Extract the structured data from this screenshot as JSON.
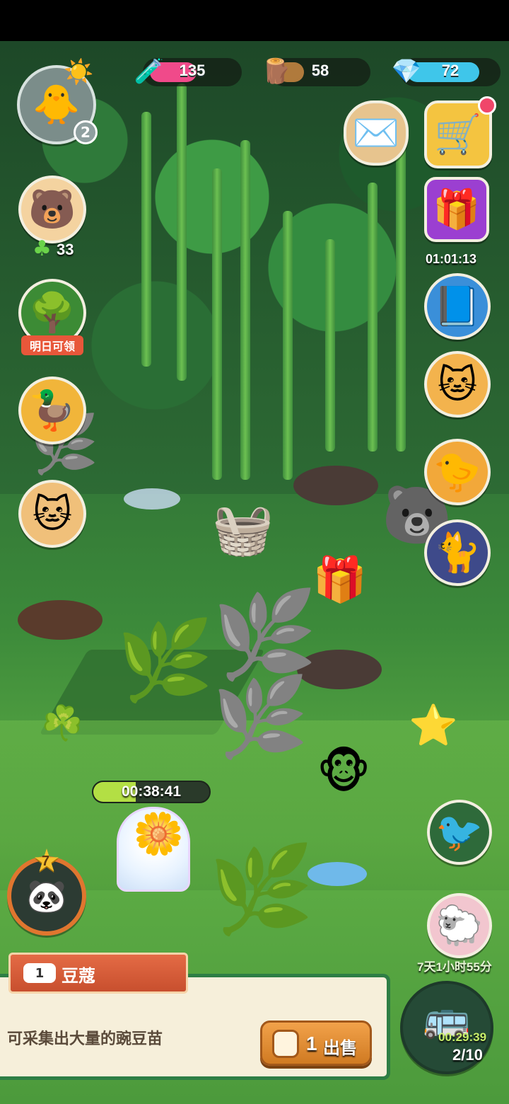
{
  "resources": {
    "potion": {
      "value": "135",
      "icon": "potion-icon",
      "color": "#f04a8a"
    },
    "wood": {
      "value": "58",
      "icon": "wood-icon",
      "color": "#b07a3c"
    },
    "gem": {
      "value": "72",
      "icon": "gem-icon",
      "color": "#3fc6ea"
    }
  },
  "left_column": {
    "player_level": "2",
    "friends_clover_count": "33",
    "bush_label": "明日可领"
  },
  "right_column": {
    "chest_timer": "01:01:13",
    "shop_timer": "7天1小时55分",
    "bus_timer": "00:29:39",
    "bus_count": "2/10"
  },
  "field": {
    "growth_timer": "00:38:41"
  },
  "bottom_left": {
    "star_level": "7"
  },
  "info_panel": {
    "item_count": "1",
    "item_name": "豆蔻",
    "description": "可采集出大量的豌豆苗",
    "sell_count": "1",
    "sell_label": "出售"
  }
}
